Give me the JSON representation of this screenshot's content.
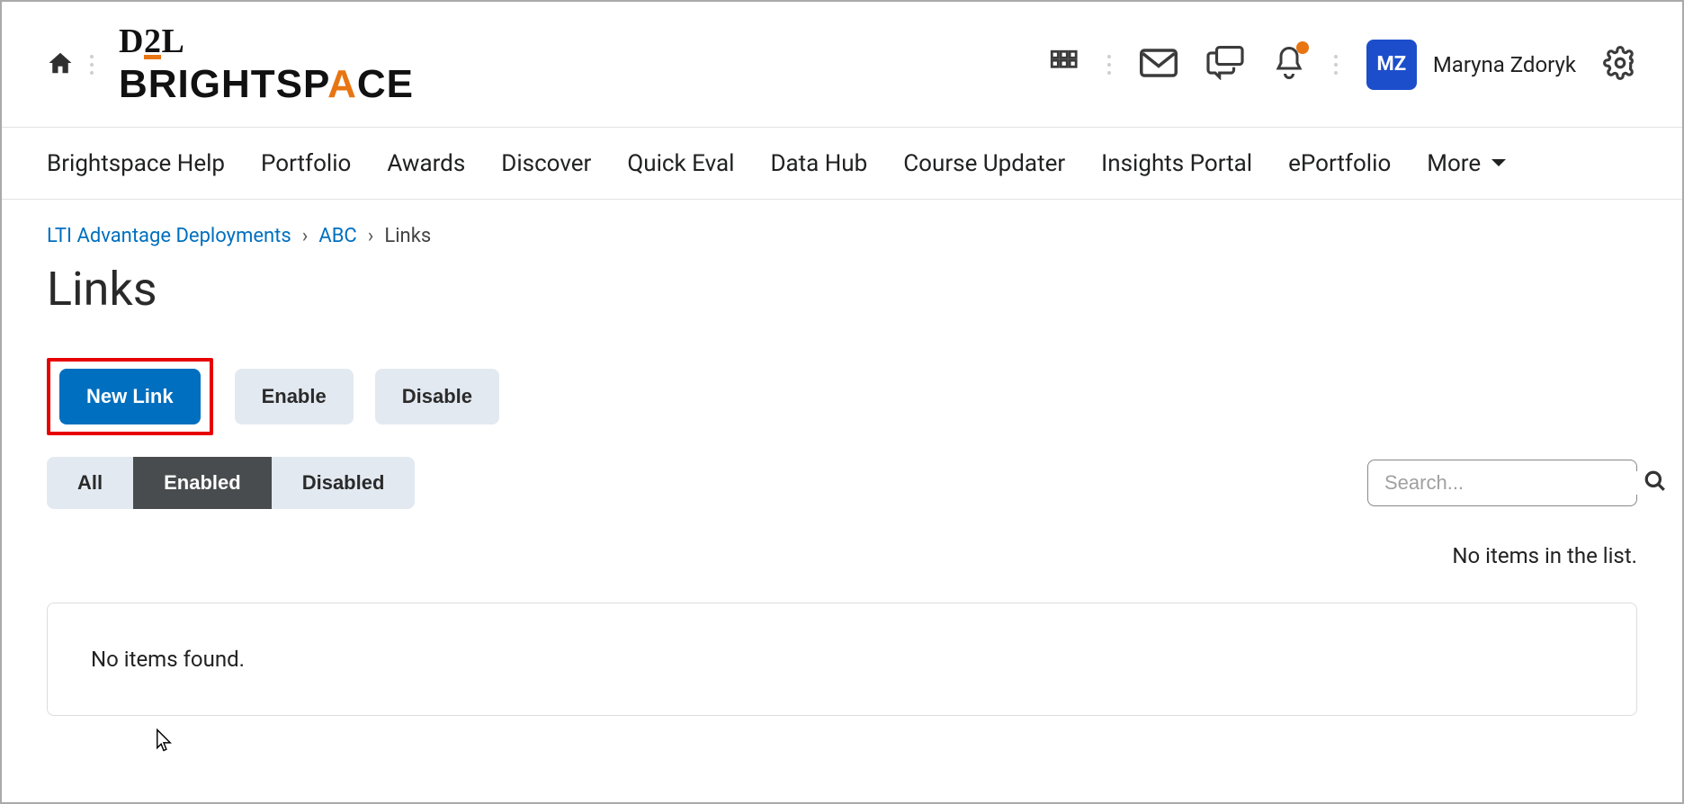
{
  "header": {
    "logo_small": "D2L",
    "logo_large_pre": "BRIGHTSP",
    "logo_large_flame": "A",
    "logo_large_post": "CE",
    "user_initials": "MZ",
    "user_name": "Maryna Zdoryk"
  },
  "nav": {
    "items": [
      "Brightspace Help",
      "Portfolio",
      "Awards",
      "Discover",
      "Quick Eval",
      "Data Hub",
      "Course Updater",
      "Insights Portal",
      "ePortfolio"
    ],
    "more_label": "More"
  },
  "breadcrumb": {
    "items": [
      {
        "label": "LTI Advantage Deployments",
        "link": true
      },
      {
        "label": "ABC",
        "link": true
      },
      {
        "label": "Links",
        "link": false
      }
    ]
  },
  "page": {
    "title": "Links"
  },
  "actions": {
    "new_link": "New Link",
    "enable": "Enable",
    "disable": "Disable"
  },
  "filters": {
    "all": "All",
    "enabled": "Enabled",
    "disabled": "Disabled",
    "active": "enabled"
  },
  "search": {
    "placeholder": "Search..."
  },
  "list": {
    "status_text": "No items in the list.",
    "empty_text": "No items found."
  }
}
